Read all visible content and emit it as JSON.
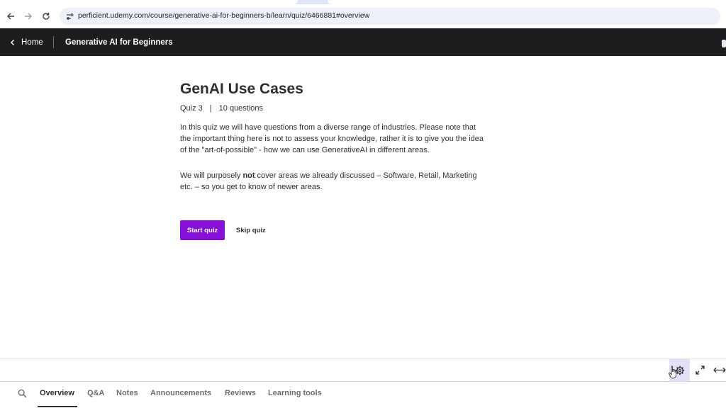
{
  "browser": {
    "url": "perficient.udemy.com/course/generative-ai-for-beginners-b/learn/quiz/6466881#overview",
    "icons": [
      "back-arrow-icon",
      "forward-arrow-icon",
      "reload-icon",
      "site-info-icon"
    ]
  },
  "header": {
    "home_label": "Home",
    "course_title": "Generative AI for Beginners"
  },
  "quiz": {
    "title": "GenAI Use Cases",
    "quiz_label": "Quiz 3",
    "separator": "|",
    "questions_label": "10 questions",
    "description": "In this quiz we will have questions from a diverse range of industries. Please note that the important thing here is not to assess your knowledge, rather it is to give you the idea of the \"art-of-possible\" - how we can use GenerativeAI in different areas.",
    "note_before": "We will purposely ",
    "note_bold": "not",
    "note_after": " cover areas we already discussed – Software, Retail, Marketing etc. – so you get to know of newer areas.",
    "start_label": "Start quiz",
    "skip_label": "Skip quiz"
  },
  "tabs": {
    "items": [
      "Overview",
      "Q&A",
      "Notes",
      "Announcements",
      "Reviews",
      "Learning tools"
    ],
    "active": "Overview"
  },
  "colors": {
    "header_bg": "#1c1d1f",
    "accent": "#8710d8",
    "text": "#2d2f31"
  }
}
